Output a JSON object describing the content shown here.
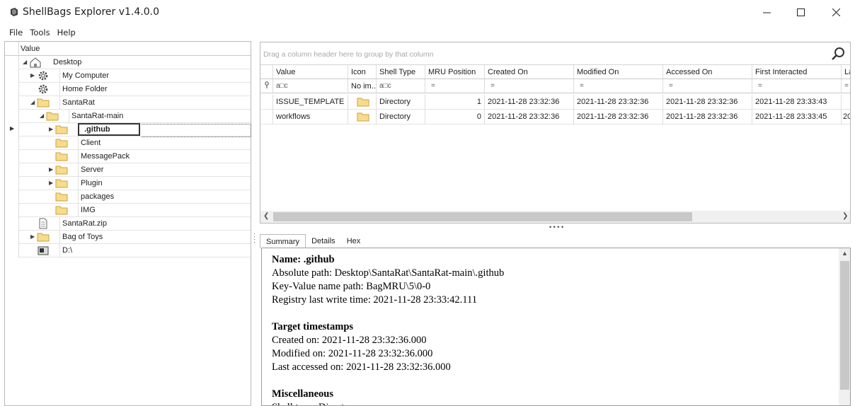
{
  "window": {
    "title": "ShellBags Explorer v1.4.0.0",
    "min_glyph": "—",
    "max_glyph": "☐",
    "close_glyph": "✕"
  },
  "menu": [
    "File",
    "Tools",
    "Help"
  ],
  "tree": {
    "header": "Value",
    "items": [
      {
        "label": "Desktop",
        "icon": "desktop-icon"
      },
      {
        "label": "My Computer",
        "icon": "gear-icon"
      },
      {
        "label": "Home Folder",
        "icon": "gear-icon"
      },
      {
        "label": "SantaRat",
        "icon": "folder-icon"
      },
      {
        "label": "SantaRat-main",
        "icon": "folder-icon"
      },
      {
        "label": ".github",
        "icon": "folder-icon"
      },
      {
        "label": "Client",
        "icon": "folder-icon"
      },
      {
        "label": "MessagePack",
        "icon": "folder-icon"
      },
      {
        "label": "Server",
        "icon": "folder-icon"
      },
      {
        "label": "Plugin",
        "icon": "folder-icon"
      },
      {
        "label": "packages",
        "icon": "folder-icon"
      },
      {
        "label": "IMG",
        "icon": "folder-icon"
      },
      {
        "label": "SantaRat.zip",
        "icon": "file-icon"
      },
      {
        "label": "Bag of Toys",
        "icon": "folder-icon"
      },
      {
        "label": "D:\\",
        "icon": "drive-icon"
      }
    ]
  },
  "grid": {
    "group_hint": "Drag a column header here to group by that column",
    "columns": [
      "Value",
      "Icon",
      "Shell Type",
      "MRU Position",
      "Created On",
      "Modified On",
      "Accessed On",
      "First Interacted",
      "La"
    ],
    "filter": {
      "value": "a□c",
      "icon": "No im...",
      "shell_type": "a□c",
      "eq": "="
    },
    "rows": [
      {
        "value": "ISSUE_TEMPLATE",
        "shell_type": "Directory",
        "mru": "1",
        "created": "2021-11-28 23:32:36",
        "modified": "2021-11-28 23:32:36",
        "accessed": "2021-11-28 23:32:36",
        "first": "2021-11-28 23:33:43",
        "last": ""
      },
      {
        "value": "workflows",
        "shell_type": "Directory",
        "mru": "0",
        "created": "2021-11-28 23:32:36",
        "modified": "2021-11-28 23:32:36",
        "accessed": "2021-11-28 23:32:36",
        "first": "2021-11-28 23:33:45",
        "last": "20"
      }
    ]
  },
  "tabs": [
    "Summary",
    "Details",
    "Hex"
  ],
  "summary": {
    "name": "Name: .github",
    "absolute_path": "Absolute path: Desktop\\SantaRat\\SantaRat-main\\.github",
    "key_value": "Key-Value name path: BagMRU\\5\\0-0",
    "registry_write": "Registry last write time: 2021-11-28 23:33:42.111",
    "target_heading": "Target timestamps",
    "created": "Created on: 2021-11-28 23:32:36.000",
    "modified": "Modified on: 2021-11-28 23:32:36.000",
    "accessed": "Last accessed on: 2021-11-28 23:32:36.000",
    "misc_heading": "Miscellaneous",
    "shell_type": "Shell type: Directory"
  }
}
